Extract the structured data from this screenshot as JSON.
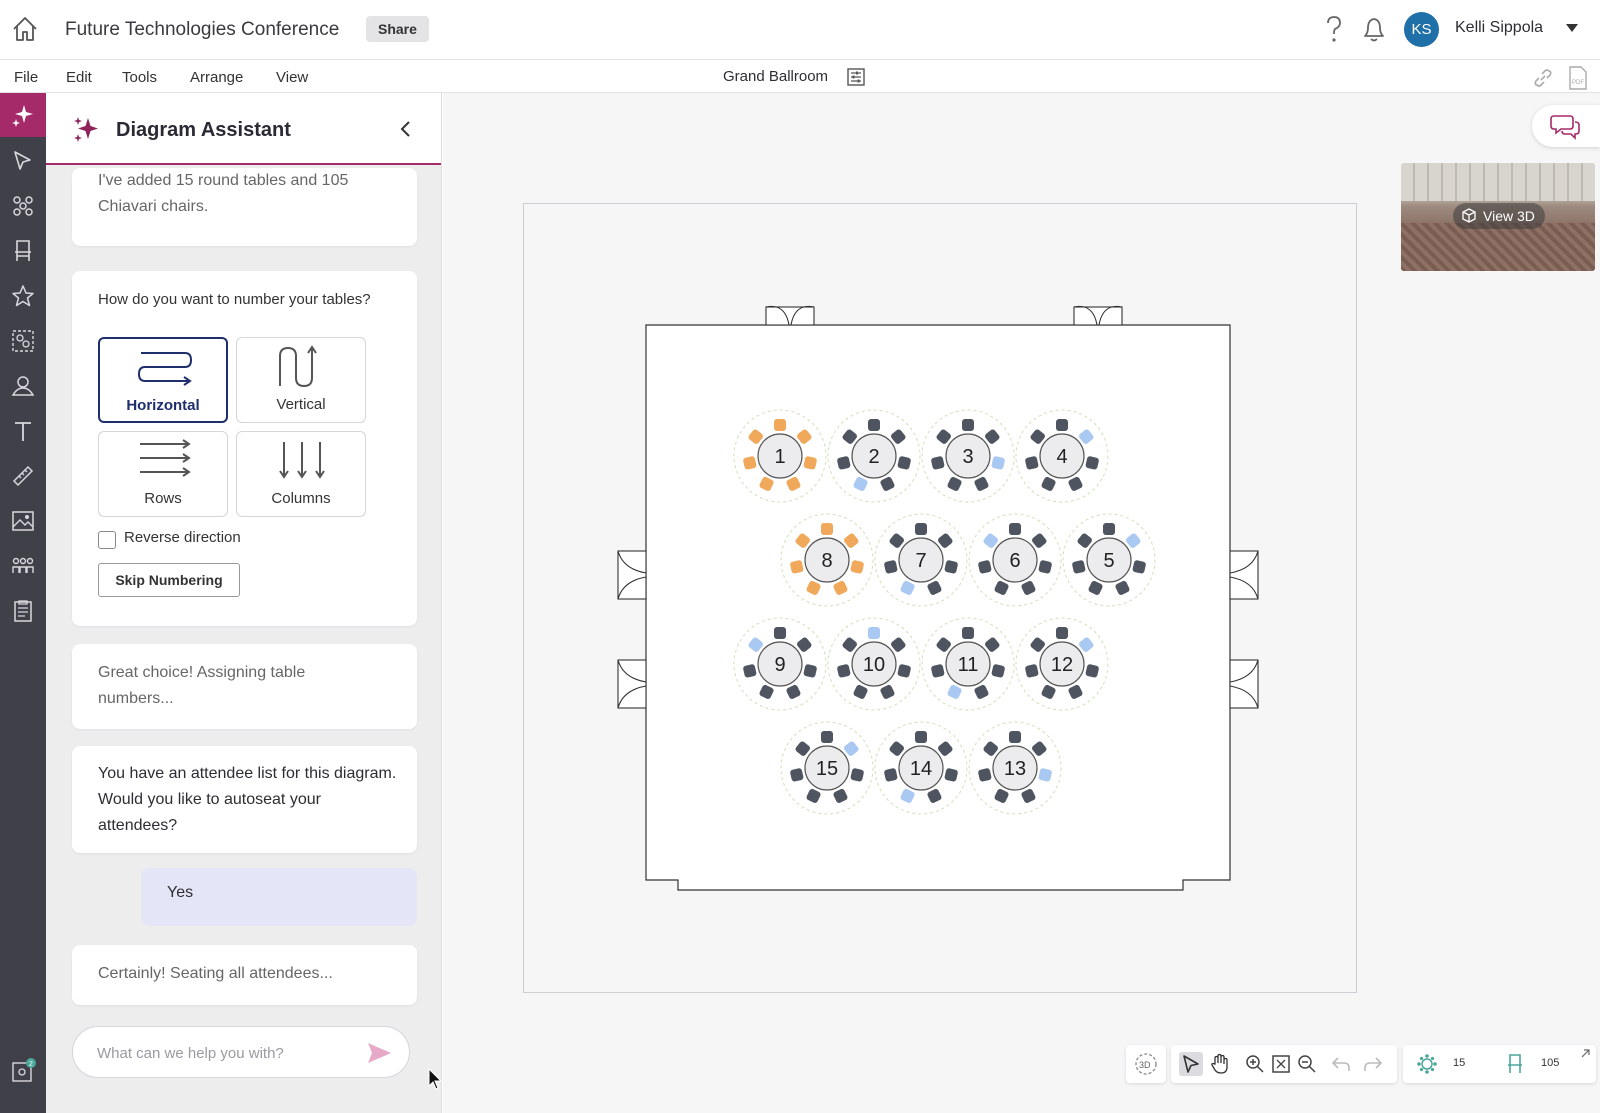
{
  "topbar": {
    "document_title": "Future Technologies Conference",
    "share_label": "Share",
    "user_initials": "KS",
    "user_name": "Kelli Sippola",
    "avatar_color": "#1f6fa8"
  },
  "menubar": {
    "items": [
      "File",
      "Edit",
      "Tools",
      "Arrange",
      "View"
    ],
    "room_title": "Grand Ballroom"
  },
  "rail": {
    "accent_color": "#a52a6a",
    "icons": [
      "sparkle-icon",
      "pointer-icon",
      "tables-icon",
      "chair-icon",
      "star-icon",
      "group-select-icon",
      "attendee-pin-icon",
      "text-icon",
      "ruler-icon",
      "image-icon",
      "people-icon",
      "clipboard-icon",
      "settings-badge-icon"
    ],
    "notification_count": "2"
  },
  "assistant": {
    "title": "Diagram Assistant",
    "messages": {
      "added": "I've added 15 round tables and 105 Chiavari chairs.",
      "question": "How do you want to number your tables?",
      "great_choice": "Great choice! Assigning table numbers...",
      "attendee_prompt": "You have an attendee list for this diagram. Would you like to autoseat your attendees?",
      "user_reply": "Yes",
      "seating": "Certainly! Seating all attendees..."
    },
    "numbering_options": [
      {
        "label": "Horizontal",
        "selected": true
      },
      {
        "label": "Vertical",
        "selected": false
      },
      {
        "label": "Rows",
        "selected": false
      },
      {
        "label": "Columns",
        "selected": false
      }
    ],
    "reverse_direction_label": "Reverse direction",
    "reverse_direction_checked": false,
    "skip_label": "Skip Numbering",
    "input_placeholder": "What can we help you with?"
  },
  "canvas": {
    "view3d_label": "View 3D",
    "tables": [
      {
        "number": "1",
        "orange": [
          0,
          1,
          2,
          3,
          4,
          5,
          6
        ],
        "blue": []
      },
      {
        "number": "2",
        "orange": [],
        "blue": [
          4
        ]
      },
      {
        "number": "3",
        "orange": [],
        "blue": [
          2
        ]
      },
      {
        "number": "4",
        "orange": [],
        "blue": [
          1
        ]
      },
      {
        "number": "5",
        "orange": [],
        "blue": [
          1
        ]
      },
      {
        "number": "6",
        "orange": [],
        "blue": [
          6
        ]
      },
      {
        "number": "7",
        "orange": [],
        "blue": [
          4
        ]
      },
      {
        "number": "8",
        "orange": [
          0,
          1,
          2,
          3,
          4,
          5,
          6
        ],
        "blue": []
      },
      {
        "number": "9",
        "orange": [],
        "blue": [
          6
        ]
      },
      {
        "number": "10",
        "orange": [],
        "blue": [
          0
        ]
      },
      {
        "number": "11",
        "orange": [],
        "blue": [
          4
        ]
      },
      {
        "number": "12",
        "orange": [],
        "blue": [
          1
        ]
      },
      {
        "number": "13",
        "orange": [],
        "blue": [
          2
        ]
      },
      {
        "number": "14",
        "orange": [],
        "blue": [
          4
        ]
      },
      {
        "number": "15",
        "orange": [],
        "blue": [
          1
        ]
      }
    ],
    "chair_colors": {
      "default": "#4f5560",
      "orange": "#f0a85a",
      "blue": "#a9c8f2"
    }
  },
  "toolbar": {
    "table_count": "15",
    "chair_count": "105"
  }
}
